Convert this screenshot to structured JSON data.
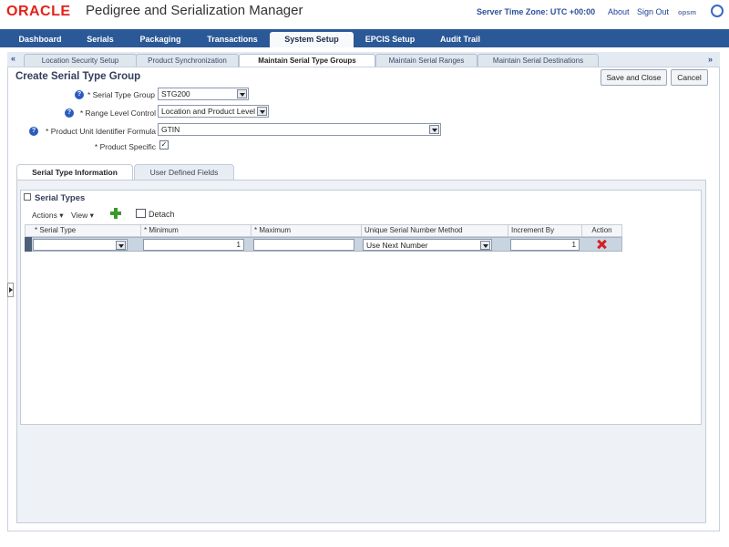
{
  "header": {
    "logo": "ORACLE",
    "app_title": "Pedigree and Serialization Manager",
    "server_time": "Server Time Zone: UTC +00:00",
    "about": "About",
    "sign_out": "Sign Out",
    "user": "opsm"
  },
  "main_tabs": [
    "Dashboard",
    "Serials",
    "Packaging",
    "Transactions",
    "System Setup",
    "EPCIS Setup",
    "Audit Trail"
  ],
  "main_tab_active": "System Setup",
  "sub_tabs": [
    "Location Security Setup",
    "Product Synchronization",
    "Maintain Serial Type Groups",
    "Maintain Serial Ranges",
    "Maintain Serial Destinations"
  ],
  "sub_tab_active": "Maintain Serial Type Groups",
  "sub_nav": {
    "left": "«",
    "right": "»"
  },
  "page": {
    "title": "Create Serial Type Group",
    "save_close": "Save and Close",
    "cancel": "Cancel"
  },
  "form": {
    "serial_type_group": {
      "label": "* Serial Type Group",
      "value": "STG200"
    },
    "range_level_control": {
      "label": "* Range Level Control",
      "value": "Location and Product Level"
    },
    "product_unit_identifier": {
      "label": "* Product Unit Identifier Formula",
      "value": "GTIN"
    },
    "product_specific": {
      "label": "* Product Specific",
      "checked": true
    }
  },
  "detail_tabs": [
    "Serial Type Information",
    "User Defined Fields"
  ],
  "serial_types": {
    "heading": "Serial Types",
    "toolbar": {
      "actions": "Actions",
      "view": "View",
      "detach": "Detach"
    },
    "columns": [
      "* Serial Type",
      "* Minimum",
      "* Maximum",
      "Unique Serial Number Method",
      "Increment By",
      "Action"
    ],
    "rows": [
      {
        "serial_type": "",
        "minimum": "1",
        "maximum": "",
        "method": "Use Next Number",
        "increment": "1"
      }
    ]
  },
  "colors": {
    "accent": "#2b5897",
    "brand": "#e2231a",
    "delete": "#d32020"
  }
}
